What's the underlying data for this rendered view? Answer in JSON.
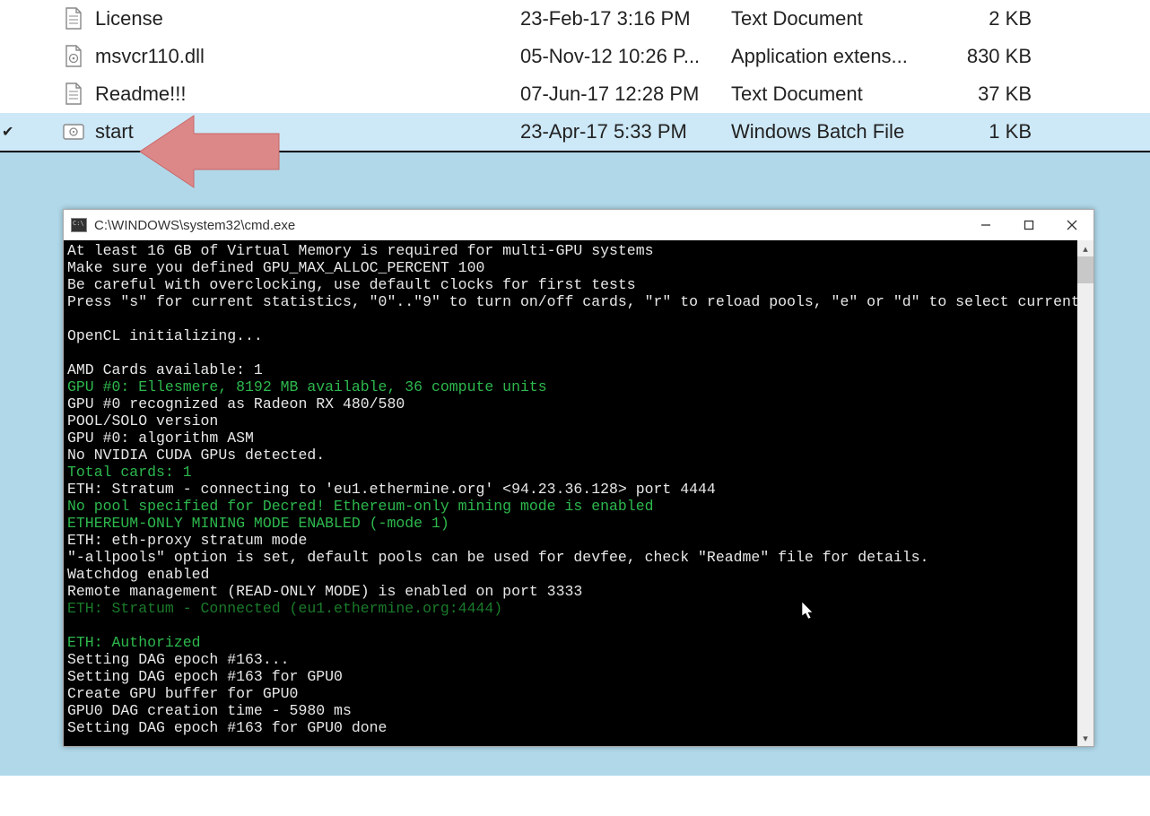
{
  "files": [
    {
      "name": "License",
      "date": "23-Feb-17 3:16 PM",
      "type": "Text Document",
      "size": "2 KB",
      "icon": "text",
      "selected": false
    },
    {
      "name": "msvcr110.dll",
      "date": "05-Nov-12 10:26 P...",
      "type": "Application extens...",
      "size": "830 KB",
      "icon": "dll",
      "selected": false
    },
    {
      "name": "Readme!!!",
      "date": "07-Jun-17 12:28 PM",
      "type": "Text Document",
      "size": "37 KB",
      "icon": "text",
      "selected": false
    },
    {
      "name": "start",
      "date": "23-Apr-17 5:33 PM",
      "type": "Windows Batch File",
      "size": "1 KB",
      "icon": "batch",
      "selected": true
    }
  ],
  "cmd": {
    "title": "C:\\WINDOWS\\system32\\cmd.exe",
    "lines": [
      {
        "t": "At least 16 GB of Virtual Memory is required for multi-GPU systems",
        "c": ""
      },
      {
        "t": "Make sure you defined GPU_MAX_ALLOC_PERCENT 100",
        "c": ""
      },
      {
        "t": "Be careful with overclocking, use default clocks for first tests",
        "c": ""
      },
      {
        "t": "Press \"s\" for current statistics, \"0\"..\"9\" to turn on/off cards, \"r\" to reload pools, \"e\" or \"d\" to select current pool",
        "c": ""
      },
      {
        "t": "",
        "c": ""
      },
      {
        "t": "OpenCL initializing...",
        "c": ""
      },
      {
        "t": "",
        "c": ""
      },
      {
        "t": "AMD Cards available: 1",
        "c": ""
      },
      {
        "t": "GPU #0: Ellesmere, 8192 MB available, 36 compute units",
        "c": "g"
      },
      {
        "t": "GPU #0 recognized as Radeon RX 480/580",
        "c": ""
      },
      {
        "t": "POOL/SOLO version",
        "c": ""
      },
      {
        "t": "GPU #0: algorithm ASM",
        "c": ""
      },
      {
        "t": "No NVIDIA CUDA GPUs detected.",
        "c": ""
      },
      {
        "t": "Total cards: 1",
        "c": "g"
      },
      {
        "t": "ETH: Stratum - connecting to 'eu1.ethermine.org' <94.23.36.128> port 4444",
        "c": ""
      },
      {
        "t": "No pool specified for Decred! Ethereum-only mining mode is enabled",
        "c": "g"
      },
      {
        "t": "ETHEREUM-ONLY MINING MODE ENABLED (-mode 1)",
        "c": "g"
      },
      {
        "t": "ETH: eth-proxy stratum mode",
        "c": ""
      },
      {
        "t": "\"-allpools\" option is set, default pools can be used for devfee, check \"Readme\" file for details.",
        "c": ""
      },
      {
        "t": "Watchdog enabled",
        "c": ""
      },
      {
        "t": "Remote management (READ-ONLY MODE) is enabled on port 3333",
        "c": ""
      },
      {
        "t": "ETH: Stratum - Connected (eu1.ethermine.org:4444)",
        "c": "dg"
      },
      {
        "t": "",
        "c": ""
      },
      {
        "t": "ETH: Authorized",
        "c": "g"
      },
      {
        "t": "Setting DAG epoch #163...",
        "c": ""
      },
      {
        "t": "Setting DAG epoch #163 for GPU0",
        "c": ""
      },
      {
        "t": "Create GPU buffer for GPU0",
        "c": ""
      },
      {
        "t": "GPU0 DAG creation time - 5980 ms",
        "c": ""
      },
      {
        "t": "Setting DAG epoch #163 for GPU0 done",
        "c": ""
      }
    ]
  }
}
